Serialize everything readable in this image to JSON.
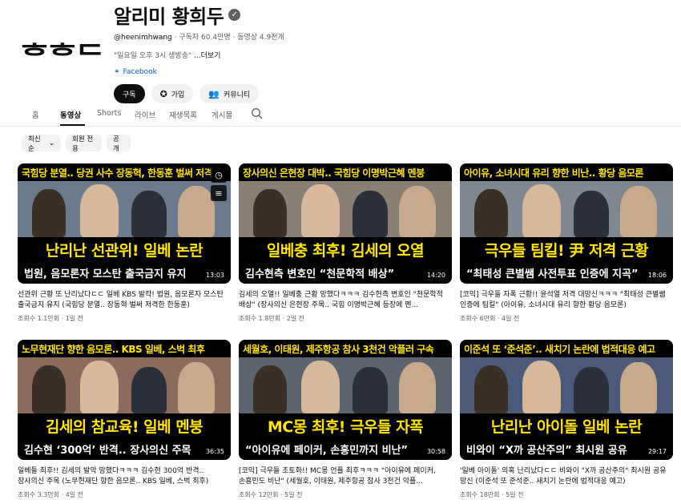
{
  "channel": {
    "avatar_text": "ᄒᄒᄃ",
    "name": "알리미 황희두",
    "handle": "@heenimhwang",
    "stats": "· 구독자 60.4만명 · 동영상 4.9천개",
    "description": "\"일요일 오후 3시 생방송\"",
    "more": "...더보기",
    "link_label": "Facebook",
    "buttons": {
      "subscribe": "구독",
      "join": "가입",
      "community": "커뮤니티"
    }
  },
  "tabs": [
    "홈",
    "동영상",
    "Shorts",
    "라이브",
    "재생목록",
    "게시물"
  ],
  "active_tab": "동영상",
  "filters": {
    "sort": "최신순",
    "members": "회원 전용",
    "public": "공개"
  },
  "videos": [
    {
      "thumb_top": "국힘당 분열.. 당권 사수 장동혁, 한동훈 벌써 저격",
      "thumb_big": "난리난 선관위! 일베 논란",
      "thumb_sub": "법원, 음모론자 모스탄 출국금지 유지",
      "duration": "13:03",
      "title": "선관위 근황 또 난리났다ㄷㄷ 일베 KBS 발칵! 법원, 음모론자 모스탄 출국금지 유지 (국힘당 분열.. 장동혁 벌써 저격한 한동훈)",
      "meta": "조회수 1.1만회 · 1일 전",
      "photo_bg": "#6b7a8c"
    },
    {
      "thumb_top": "장사의신 은현장 대박.. 국힘당 이명박근혜 멘붕",
      "thumb_big": "일베충 최후! 김세의 오열",
      "thumb_sub": "김수현측 변호인 “천문학적 배상”",
      "duration": "14:20",
      "title": "김세의 오열!! 일베충 근황 망했다ㅋㅋㅋ 김수현측 변호인 \"천문학적 배상\" (장사의신 은현장 주목.. 국힘 이명박근혜 등장에 멘...",
      "meta": "조회수 1.8만회 · 2일 전",
      "photo_bg": "#8a7f73"
    },
    {
      "thumb_top": "아이유, 소녀시대 유리 향한 비난.. 황당 음모론",
      "thumb_big": "극우들 팀킬! 尹 저격 근황",
      "thumb_sub": "“최태성 큰별쌤 사전투표 인증에 지곡”",
      "duration": "18:06",
      "title": "[코믹] 극우들 자폭 근황!! 윤석열 저격 대망신ㅋㅋㅋ \"최태성 큰별쌤 인증에 팀킬\" (아이유, 소녀시대 유리 향한 황당 음모론)",
      "meta": "조회수 6만회 · 4일 전",
      "photo_bg": "#7f8790"
    },
    {
      "thumb_top": "노무현재단 향한 음모론.. KBS 일베, 스벅 최후",
      "thumb_big": "김세의 참교육! 일베 멘붕",
      "thumb_sub": "김수현 ‘300억’ 반격.. 장사의신 주목",
      "duration": "36:35",
      "title": "일베들 최후!! 김세의 발악 망했다ㅋㅋㅋ 김수현 300억 반격.. 장사의신 주목 (노무현재단 향한 음모론.. KBS 일베, 스벅 최후)",
      "meta": "조회수 3.3만회 · 4일 전",
      "photo_bg": "#8c6b5c"
    },
    {
      "thumb_top": "세월호, 이태원, 제주항공 참사 3천건 악플러 구속",
      "thumb_big": "MC몽 최후! 극우들 자폭",
      "thumb_sub": "“아이유에 페이커, 손흥민까지 비난”",
      "duration": "30:58",
      "title": "[코믹] 극우들 초토화!! MC몽 언플 최후ㅋㅋㅋ \"아이유에 페이커, 손흥민도 비난\" (세월호, 이태원, 제주항공 참사 3천건 악플...",
      "meta": "조회수 12만회 · 5일 전",
      "photo_bg": "#5c6470"
    },
    {
      "thumb_top": "이준석 또 ‘준석준’.. 새치기 논란에 법적대응 예고",
      "thumb_big": "난리난 아이돌 일베 논란",
      "thumb_sub": "비와이 “X까 공산주의” 최시원 공유",
      "duration": "29:17",
      "title": "'일베 아이돌' 의혹 난리났다ㄷㄷ 비와이 \"X까 공산주의\" 최시원 공유 망신 (이준석 또 준석준.. 새치기 논란에 법적대응 예고)",
      "meta": "조회수 18만회 · 5일 전",
      "photo_bg": "#4a5a78"
    }
  ]
}
